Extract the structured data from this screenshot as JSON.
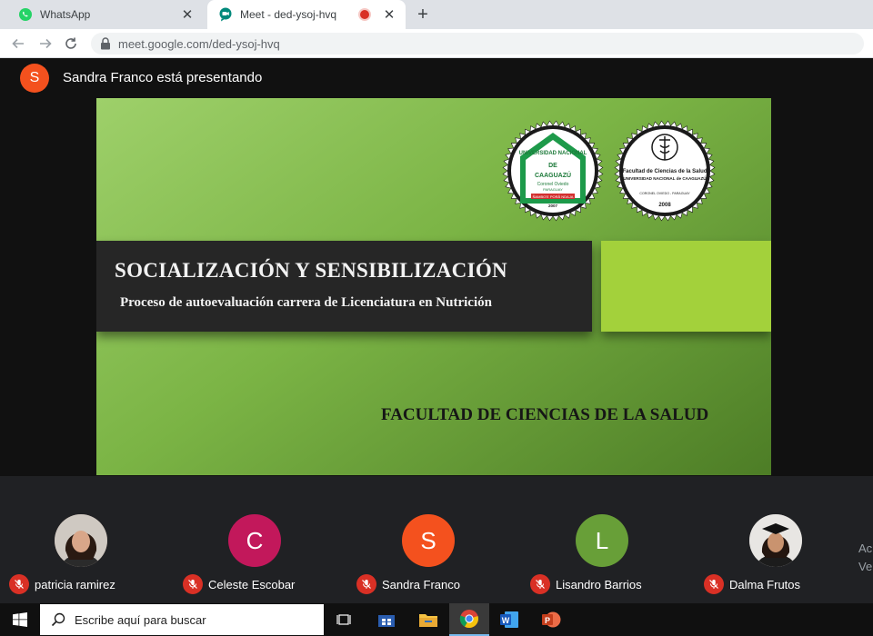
{
  "browser": {
    "tabs": [
      {
        "label": "WhatsApp",
        "icon": "whatsapp-icon",
        "active": false
      },
      {
        "label": "Meet - ded-ysoj-hvq",
        "icon": "meet-icon",
        "active": true,
        "recording": true
      }
    ],
    "url": "meet.google.com/ded-ysoj-hvq"
  },
  "meet": {
    "presenter_initial": "S",
    "presenter_text": "Sandra Franco está presentando",
    "slide": {
      "title": "SOCIALIZACIÓN Y SENSIBILIZACIÓN",
      "subtitle": "Proceso de autoevaluación carrera de Licenciatura en Nutrición",
      "faculty": "FACULTAD DE CIENCIAS DE LA SALUD",
      "seal_left": {
        "top_text": "UNIVERSIDAD NACIONAL",
        "de": "DE",
        "name": "CAAGUAZÚ",
        "city": "Coronel Oviedo",
        "country": "PARAGUAY",
        "motto": "ÑAMBO'E PORÃ NDAJA",
        "year": "2007"
      },
      "seal_right": {
        "line1": "Facultad de Ciencias de la Salud",
        "line2": "UNIVERSIDAD NACIONAL de CAAGUAZÚ",
        "line3": "CORONEL OVIEDO - PARAGUAY",
        "year": "2008"
      }
    },
    "participants": [
      {
        "name": "patricia ramirez",
        "initial": "",
        "color": "#7a5a4a",
        "photo": true,
        "muted": true
      },
      {
        "name": "Celeste Escobar",
        "initial": "C",
        "color": "#c2185b",
        "photo": false,
        "muted": true
      },
      {
        "name": "Sandra Franco",
        "initial": "S",
        "color": "#f4511e",
        "photo": false,
        "muted": true
      },
      {
        "name": "Lisandro Barrios",
        "initial": "L",
        "color": "#689f38",
        "photo": false,
        "muted": true
      },
      {
        "name": "Dalma Frutos",
        "initial": "",
        "color": "#6d6d6d",
        "photo": true,
        "muted": true
      }
    ],
    "edge_text": [
      "Ac",
      "Ve"
    ]
  },
  "taskbar": {
    "search_placeholder": "Escribe aquí para buscar",
    "apps": [
      "task-view-icon",
      "store-icon",
      "file-explorer-icon",
      "chrome-icon",
      "word-icon",
      "powerpoint-icon"
    ],
    "active_app": "chrome-icon"
  },
  "colors": {
    "meet_bg": "#202124",
    "slide_green": "#7bb445",
    "lime": "#a3d13b",
    "mic_off_red": "#d93025"
  }
}
